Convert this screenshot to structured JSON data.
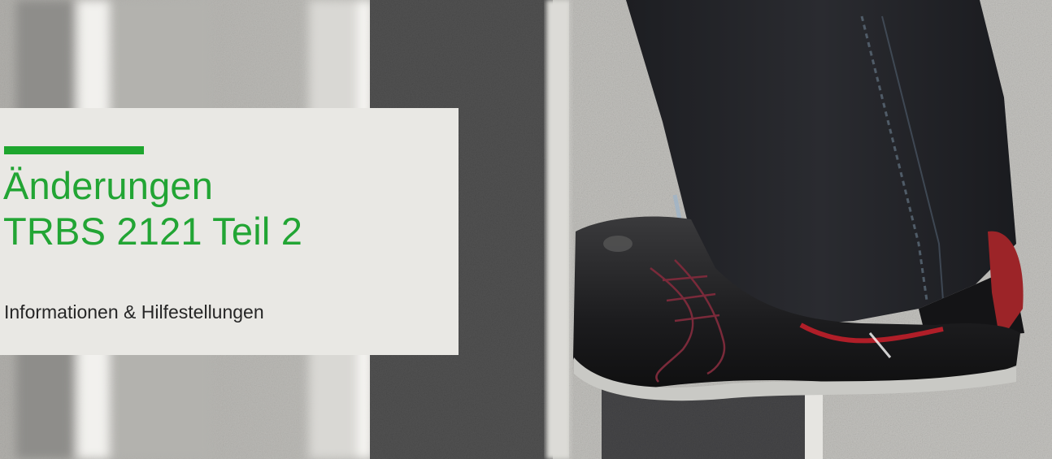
{
  "hero": {
    "title_line1": "Änderungen",
    "title_line2": "TRBS 2121 Teil 2",
    "subtitle": "Informationen & Hilfestellungen"
  },
  "colors": {
    "accent": "#1ea62e",
    "title": "#22a534",
    "box_background": "#e9e8e4",
    "subtitle": "#262626"
  }
}
